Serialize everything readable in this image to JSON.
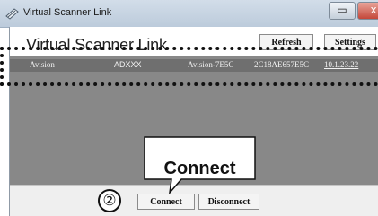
{
  "window": {
    "title": "Virtual Scanner Link",
    "minimize_symbol": "▭",
    "close_symbol": "x"
  },
  "header": {
    "app_title": "Virtual Scanner Link",
    "refresh_label": "Refresh",
    "settings_label": "Settings"
  },
  "device_list": {
    "rows": [
      {
        "vendor": "Avision",
        "model": "ADXXX",
        "device_name": "Avision-7E5C",
        "mac_address": "2C18AE657E5C",
        "ip_address": "10.1.23.22"
      }
    ]
  },
  "footer": {
    "step_marker": "②",
    "connect_label": "Connect",
    "disconnect_label": "Disconnect"
  },
  "callout": {
    "text": "Connect"
  },
  "colors": {
    "list_background": "#888888",
    "selected_row": "#6f6f6f",
    "footer_background": "#efefef"
  }
}
